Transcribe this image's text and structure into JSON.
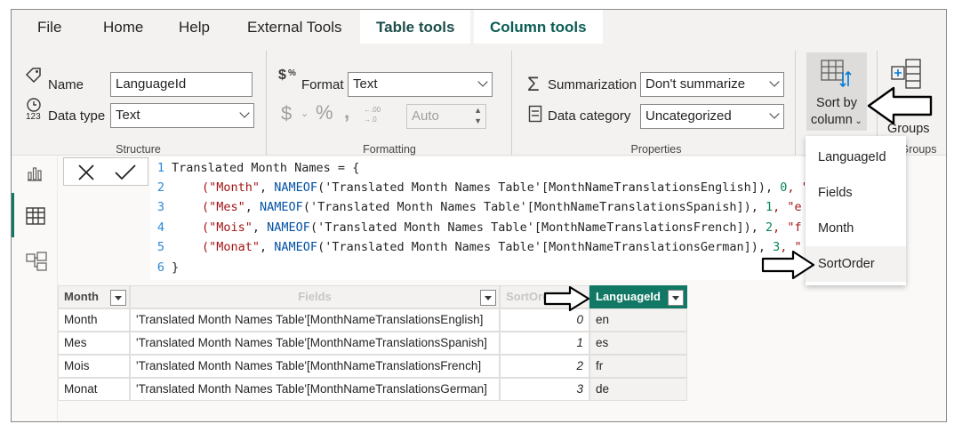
{
  "tabs": [
    "File",
    "Home",
    "Help",
    "External Tools",
    "Table tools",
    "Column tools"
  ],
  "structure": {
    "name_label": "Name",
    "name_value": "LanguageId",
    "datatype_label": "Data type",
    "datatype_value": "Text",
    "group_label": "Structure"
  },
  "formatting": {
    "format_label": "Format",
    "format_value": "Text",
    "decimals_value": "Auto",
    "group_label": "Formatting"
  },
  "properties": {
    "summarization_label": "Summarization",
    "summarization_value": "Don't summarize",
    "category_label": "Data category",
    "category_value": "Uncategorized",
    "group_label": "Properties"
  },
  "sort": {
    "label_line1": "Sort by",
    "label_line2": "column",
    "groups_label": "Groups",
    "groups_group_label": "Groups"
  },
  "sort_menu": [
    "LanguageId",
    "Fields",
    "Month",
    "SortOrder"
  ],
  "code": {
    "line_numbers": [
      "1",
      "2",
      "3",
      "4",
      "5",
      "6"
    ],
    "line1": "Translated Month Names = {",
    "line6": "}",
    "rows": [
      {
        "s": "(\"Month\"",
        "fn": "NAMEOF",
        "arg": "('Translated Month Names Table'[MonthNameTranslationsEnglish]),",
        "n": "0",
        "tail": ", \"e"
      },
      {
        "s": "(\"Mes\"",
        "fn": "NAMEOF",
        "arg": "('Translated Month Names Table'[MonthNameTranslationsSpanish]),",
        "n": "1",
        "tail": ", \"e"
      },
      {
        "s": "(\"Mois\"",
        "fn": "NAMEOF",
        "arg": "('Translated Month Names Table'[MonthNameTranslationsFrench]),",
        "n": "2",
        "tail": ", \"f"
      },
      {
        "s": "(\"Monat\"",
        "fn": "NAMEOF",
        "arg": "('Translated Month Names Table'[MonthNameTranslationsGerman]),",
        "n": "3",
        "tail": ", \""
      }
    ]
  },
  "table": {
    "headers": [
      "Month",
      "Fields",
      "SortOrder",
      "LanguageId"
    ],
    "rows": [
      [
        "Month",
        "'Translated Month Names Table'[MonthNameTranslationsEnglish]",
        "0",
        "en"
      ],
      [
        "Mes",
        "'Translated Month Names Table'[MonthNameTranslationsSpanish]",
        "1",
        "es"
      ],
      [
        "Mois",
        "'Translated Month Names Table'[MonthNameTranslationsFrench]",
        "2",
        "fr"
      ],
      [
        "Monat",
        "'Translated Month Names Table'[MonthNameTranslationsGerman]",
        "3",
        "de"
      ]
    ]
  },
  "colors": {
    "accent": "#117865",
    "ribbon": "#f3f2f1"
  }
}
